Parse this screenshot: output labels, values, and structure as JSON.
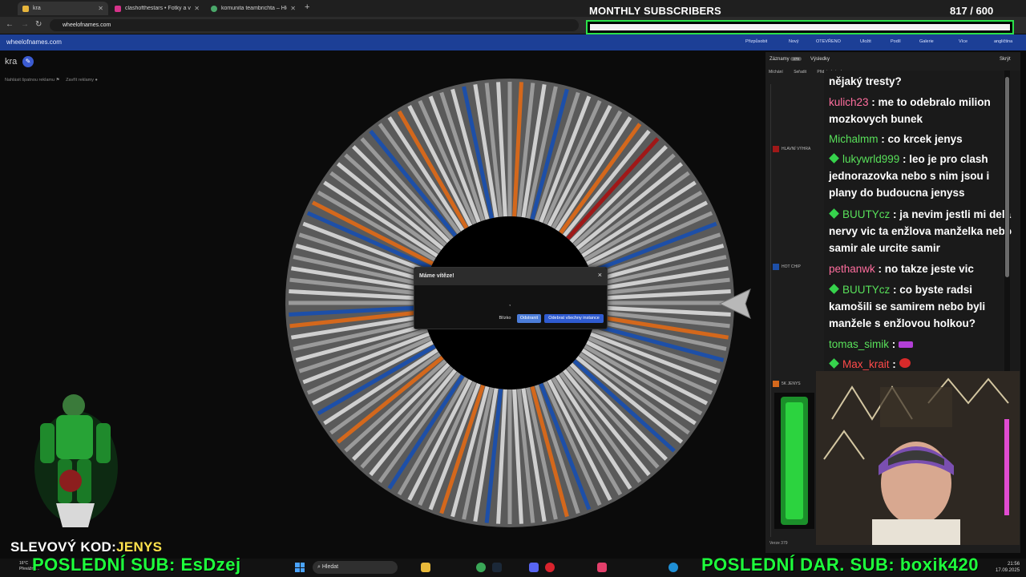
{
  "browser": {
    "tabs": [
      {
        "label": "kra",
        "icon_color": "#e7b53c"
      },
      {
        "label": "clashofthestars • Fotky a videa",
        "icon_color": "#d6338a"
      },
      {
        "label": "komunita teambrichta – Hledat",
        "icon_color": "#4aa86a"
      }
    ],
    "url": "wheelofnames.com"
  },
  "site": {
    "name": "wheelofnames.com",
    "menu": [
      "Přizpůsobit",
      "Nový",
      "OTEVŘENO",
      "Uložit",
      "Podíl",
      "Galerie",
      "Více",
      "angličtina"
    ],
    "wheel_title": "kra",
    "ad_links": [
      "Nahlásit špatnou reklamu",
      "Zavřít reklamy"
    ]
  },
  "overlay": {
    "subs_title": "MONTHLY SUBSCRIBERS",
    "subs_count": "817  / 600",
    "subs_progress": 1.0,
    "promo_label": "SLEVOVÝ KOD:",
    "promo_code": "JENYS",
    "last_sub": "POSLEDNÍ SUB: EsDzej",
    "last_gift": "POSLEDNÍ DAR. SUB: boxik420"
  },
  "dialog": {
    "title": "Máme vítěze!",
    "winner": ",",
    "close_label": "Blízko",
    "remove_label": "Odstranit",
    "remove_all_label": "Odebrat všechny instance"
  },
  "panel": {
    "tabs": [
      "Záznamy",
      "Výsledky"
    ],
    "entries_count": "379",
    "hide_label": "Skrýt",
    "tools": [
      "Míchání",
      "Seřadit",
      "Přidat obrázek"
    ],
    "entries": [
      {
        "label": "HLAVNÍ VÝHRA",
        "color": "#a01818"
      },
      {
        "label": "HOT CHIP",
        "color": "#1d4fa8"
      },
      {
        "label": "5K JENYS",
        "color": "#d4681c"
      }
    ],
    "version": "Verze 379"
  },
  "chat": [
    {
      "user": "",
      "color": "#ffffff",
      "badge": false,
      "text": "nějaký tresty?"
    },
    {
      "user": "kulich23",
      "color": "#ff6e9e",
      "badge": false,
      "text": "me to odebralo milion mozkovych bunek"
    },
    {
      "user": "Michalmm",
      "color": "#58e05a",
      "badge": false,
      "text": "co krcek jenys"
    },
    {
      "user": "lukywrld999",
      "color": "#58e05a",
      "badge": true,
      "text": "leo je pro clash jednorazovka nebo s nim jsou i plany do budoucna jenyss"
    },
    {
      "user": "BUUTYcz",
      "color": "#58e05a",
      "badge": true,
      "text": "ja nevim jestli mi dela nervy vic ta enžlova manželka nebo samir ale urcite samir"
    },
    {
      "user": "pethanwk",
      "color": "#ff6e9e",
      "badge": false,
      "text": "no takze jeste vic"
    },
    {
      "user": "BUUTYcz",
      "color": "#58e05a",
      "badge": true,
      "text": "co byste radsi kamošili se samirem nebo byli manžele s enžlovou holkou?"
    },
    {
      "user": "tomas_simik",
      "color": "#58e05a",
      "badge": false,
      "text": ""
    },
    {
      "user": "Max_krait",
      "color": "#ff4a4a",
      "badge": true,
      "text": ""
    }
  ],
  "taskbar": {
    "search_placeholder": "Hledat",
    "time": "21:56",
    "date": "17.09.2025",
    "weather_temp": "16°C",
    "weather_desc": "Převážně..."
  },
  "icons": [
    "search-icon",
    "back-icon",
    "forward-icon",
    "reload-icon",
    "close-icon",
    "edit-icon",
    "windows-icon"
  ]
}
